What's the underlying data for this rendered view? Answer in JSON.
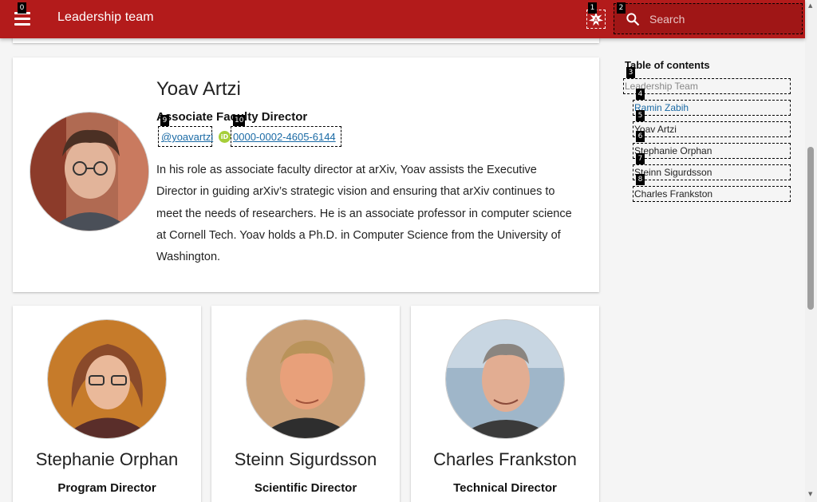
{
  "header": {
    "title": "Leadership team",
    "search_placeholder": "Search",
    "menu_icon": "hamburger-menu-icon",
    "logo_icon": "arxiv-logo-icon",
    "search_icon": "magnifier-icon",
    "brand_color": "#b31b1b"
  },
  "featured": {
    "name": "Yoav Artzi",
    "role": "Associate Faculty Director",
    "twitter": "@yoavartzi",
    "orcid": "0000-0002-4605-6144",
    "orcid_icon": "orcid-icon",
    "bio": "In his role as associate faculty director at arXiv, Yoav assists the Executive Director in guiding arXiv’s strategic vision and ensuring that arXiv continues to meet the needs of researchers. He is an associate professor in computer science at Cornell Tech. Yoav holds a Ph.D. in Computer Science from the University of Washington."
  },
  "people": [
    {
      "name": "Stephanie Orphan",
      "role": "Program Director"
    },
    {
      "name": "Steinn Sigurdsson",
      "role": "Scientific Director"
    },
    {
      "name": "Charles Frankston",
      "role": "Technical Director"
    }
  ],
  "toc": {
    "title": "Table of contents",
    "items": [
      "Leadership Team",
      "Ramin Zabih",
      "Yoav Artzi",
      "Stephanie Orphan",
      "Steinn Sigurdsson",
      "Charles Frankston"
    ]
  },
  "markers": [
    "0",
    "1",
    "2",
    "3",
    "4",
    "5",
    "6",
    "7",
    "8",
    "9",
    "10"
  ]
}
